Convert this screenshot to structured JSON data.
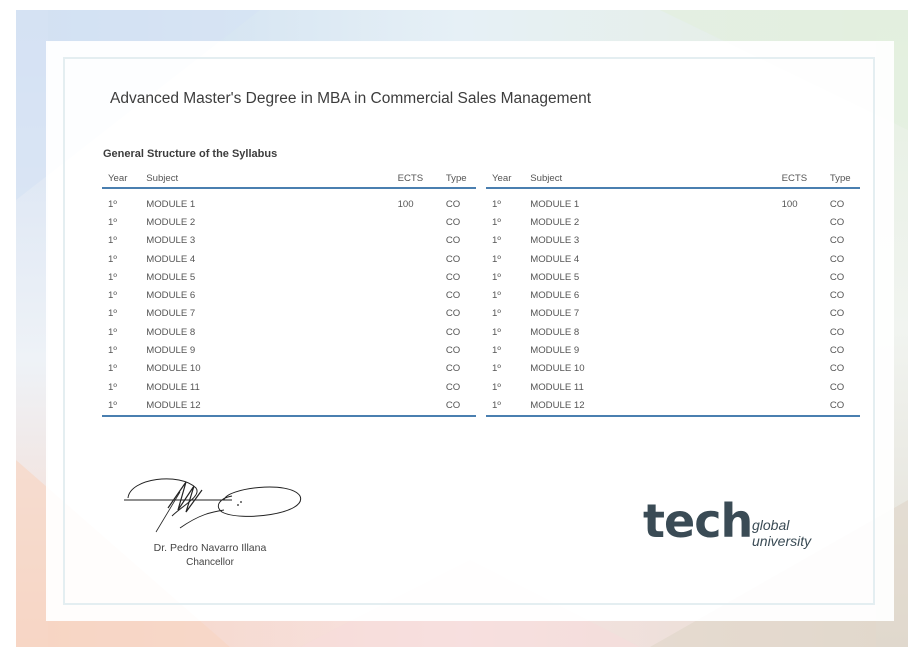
{
  "document": {
    "title": "Advanced Master's Degree in MBA in Commercial Sales Management",
    "syllabus_heading": "General Structure of the Syllabus"
  },
  "table": {
    "headers": {
      "year": "Year",
      "subject": "Subject",
      "ects": "ECTS",
      "type": "Type"
    },
    "rows": [
      {
        "year": "1º",
        "subject": "MODULE 1",
        "ects": "100",
        "type": "CO"
      },
      {
        "year": "1º",
        "subject": "MODULE 2",
        "ects": "",
        "type": "CO"
      },
      {
        "year": "1º",
        "subject": "MODULE 3",
        "ects": "",
        "type": "CO"
      },
      {
        "year": "1º",
        "subject": "MODULE 4",
        "ects": "",
        "type": "CO"
      },
      {
        "year": "1º",
        "subject": "MODULE 5",
        "ects": "",
        "type": "CO"
      },
      {
        "year": "1º",
        "subject": "MODULE 6",
        "ects": "",
        "type": "CO"
      },
      {
        "year": "1º",
        "subject": "MODULE 7",
        "ects": "",
        "type": "CO"
      },
      {
        "year": "1º",
        "subject": "MODULE 8",
        "ects": "",
        "type": "CO"
      },
      {
        "year": "1º",
        "subject": "MODULE 9",
        "ects": "",
        "type": "CO"
      },
      {
        "year": "1º",
        "subject": "MODULE 10",
        "ects": "",
        "type": "CO"
      },
      {
        "year": "1º",
        "subject": "MODULE 11",
        "ects": "",
        "type": "CO"
      },
      {
        "year": "1º",
        "subject": "MODULE 12",
        "ects": "",
        "type": "CO"
      }
    ]
  },
  "signer": {
    "name": "Dr. Pedro Navarro Illana",
    "role": "Chancellor"
  },
  "logo": {
    "word": "tech",
    "line1": "global",
    "line2": "university",
    "color": "#3a4b55"
  },
  "colors": {
    "rule": "#4a7fb0",
    "text": "#3a3a3a"
  }
}
